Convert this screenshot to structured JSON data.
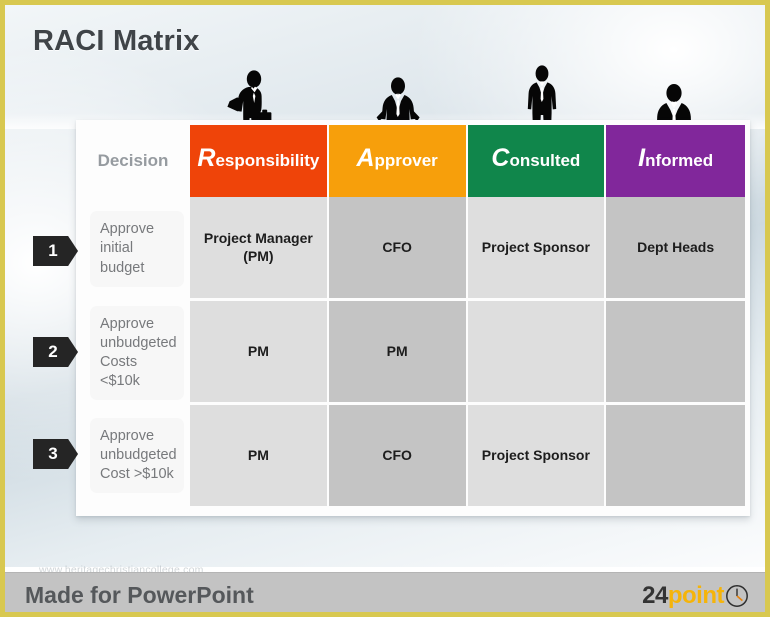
{
  "slide": {
    "title": "RACI Matrix",
    "border_color": "#d8c850"
  },
  "table": {
    "decision_header": "Decision",
    "columns": [
      {
        "initial": "R",
        "rest": "esponsibility",
        "color": "#ef4409",
        "icon": "businessman-briefcase-silhouette-icon"
      },
      {
        "initial": "A",
        "rest": "pprover",
        "color": "#f79f0b",
        "icon": "businessman-hands-on-hips-silhouette-icon"
      },
      {
        "initial": "C",
        "rest": "onsulted",
        "color": "#10864b",
        "icon": "businessman-standing-silhouette-icon"
      },
      {
        "initial": "I",
        "rest": "nformed",
        "color": "#81279b",
        "icon": "businessman-arms-crossed-silhouette-icon"
      }
    ],
    "rows": [
      {
        "number": "1",
        "decision": "Approve initial budget",
        "responsibility": "Project Manager (PM)",
        "approver": "CFO",
        "consulted": "Project Sponsor",
        "informed": "Dept Heads"
      },
      {
        "number": "2",
        "decision": "Approve unbudgeted Costs <$10k",
        "responsibility": "PM",
        "approver": "PM",
        "consulted": "",
        "informed": ""
      },
      {
        "number": "3",
        "decision": "Approve unbudgeted Cost >$10k",
        "responsibility": "PM",
        "approver": "CFO",
        "consulted": "Project Sponsor",
        "informed": ""
      }
    ]
  },
  "watermark": "www.heritagechristiancollege.com",
  "footer": {
    "text": "Made for PowerPoint",
    "logo_number": "24",
    "logo_word": "point",
    "logo_icon": "clock-icon",
    "logo_number_color": "#333333",
    "logo_word_color": "#f5b40a"
  }
}
